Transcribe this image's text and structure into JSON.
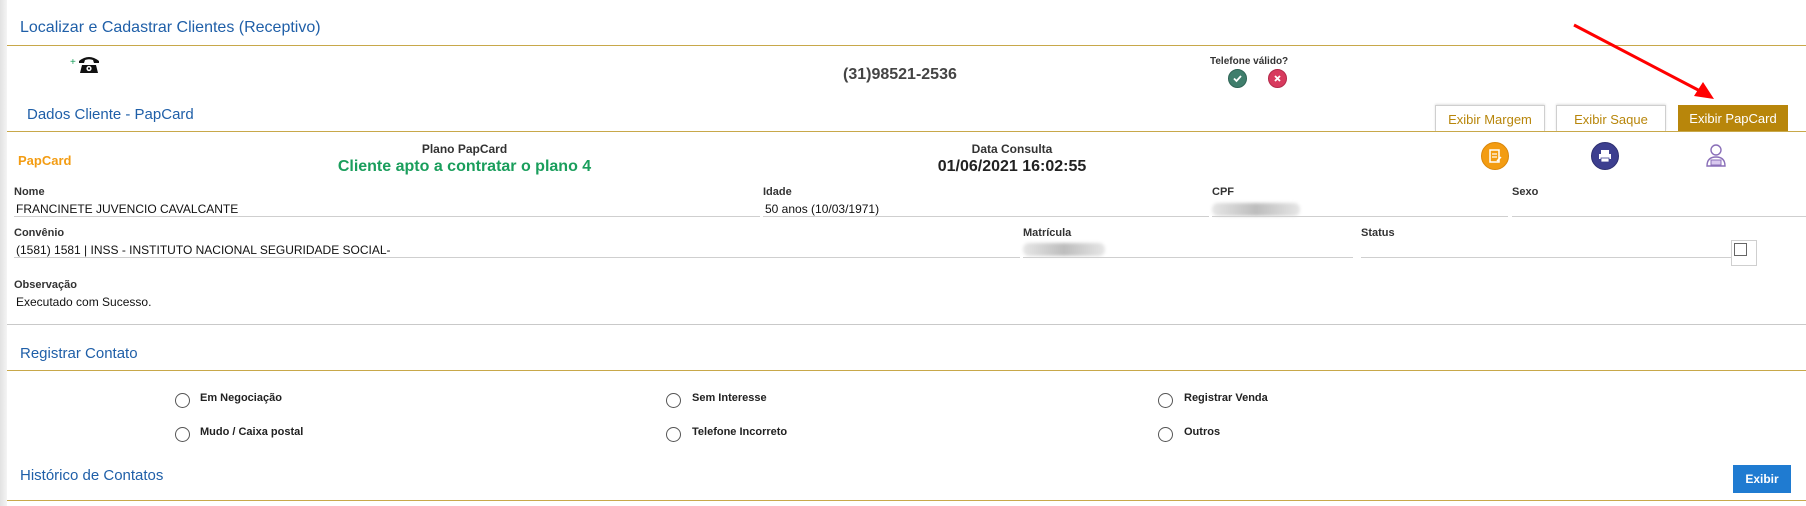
{
  "header": {
    "title": "Localizar e Cadastrar Clientes (Receptivo)"
  },
  "phone": {
    "plus": "+",
    "icon": "telephone-icon",
    "number": "(31)98521-2536",
    "valid_label": "Telefone válido?"
  },
  "dados": {
    "title": "Dados Cliente - PapCard",
    "buttons": {
      "margem": "Exibir Margem",
      "saque": "Exibir Saque",
      "papcard": "Exibir PapCard"
    }
  },
  "papcard": {
    "brand": "PapCard",
    "plano_label": "Plano PapCard",
    "plano_value": "Cliente apto a contratar o plano 4",
    "data_label": "Data Consulta",
    "data_value": "01/06/2021 16:02:55"
  },
  "cliente": {
    "nome_label": "Nome",
    "nome": "FRANCINETE JUVENCIO CAVALCANTE",
    "idade_label": "Idade",
    "idade": "50 anos (10/03/1971)",
    "cpf_label": "CPF",
    "sexo_label": "Sexo",
    "convenio_label": "Convênio",
    "convenio": "(1581) 1581 | INSS - INSTITUTO NACIONAL SEGURIDADE SOCIAL-",
    "matricula_label": "Matrícula",
    "status_label": "Status",
    "observacao_label": "Observação",
    "observacao": "Executado com Sucesso."
  },
  "registrar": {
    "title": "Registrar Contato",
    "options": [
      "Em Negociação",
      "Sem Interesse",
      "Registrar Venda",
      "Mudo / Caixa postal",
      "Telefone Incorreto",
      "Outros"
    ]
  },
  "historico": {
    "title": "Histórico de Contatos",
    "button": "Exibir"
  },
  "colors": {
    "accent_blue": "#1f5fa8",
    "gold": "#b8860b",
    "green": "#1a9e5c",
    "brand_orange": "#f39c12",
    "annotation_red": "#ff0000"
  }
}
